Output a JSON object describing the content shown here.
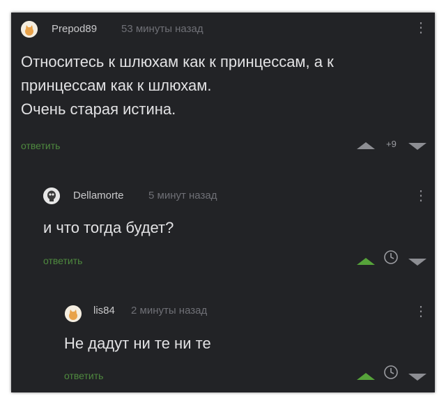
{
  "comments": [
    {
      "author": "Prepod89",
      "time": "53 минуты назад",
      "text": "Относитесь к шлюхам как к принцессам, а к\nпринцессам как к шлюхам.\nОчень старая истина.",
      "reply": "ответить",
      "rating": "+9",
      "upvote_icon": "triangle-up-icon",
      "downvote_icon": "triangle-down-icon"
    },
    {
      "author": "Dellamorte",
      "time": "5 минут назад",
      "text": "и что тогда будет?",
      "reply": "ответить",
      "upvote_icon": "triangle-up-icon",
      "status_icon": "clock-icon",
      "downvote_icon": "triangle-down-icon"
    },
    {
      "author": "lis84",
      "time": "2 минуты назад",
      "text": "Не дадут ни те ни те",
      "reply": "ответить",
      "upvote_icon": "triangle-up-icon",
      "status_icon": "clock-icon",
      "downvote_icon": "triangle-down-icon"
    }
  ],
  "colors": {
    "background": "#222326",
    "text": "#e2e2e4",
    "author": "#c9c9cb",
    "meta": "#6f7076",
    "reply": "#4f8a3f",
    "upvote_active": "#56a33a",
    "icon": "#8d8e93"
  }
}
